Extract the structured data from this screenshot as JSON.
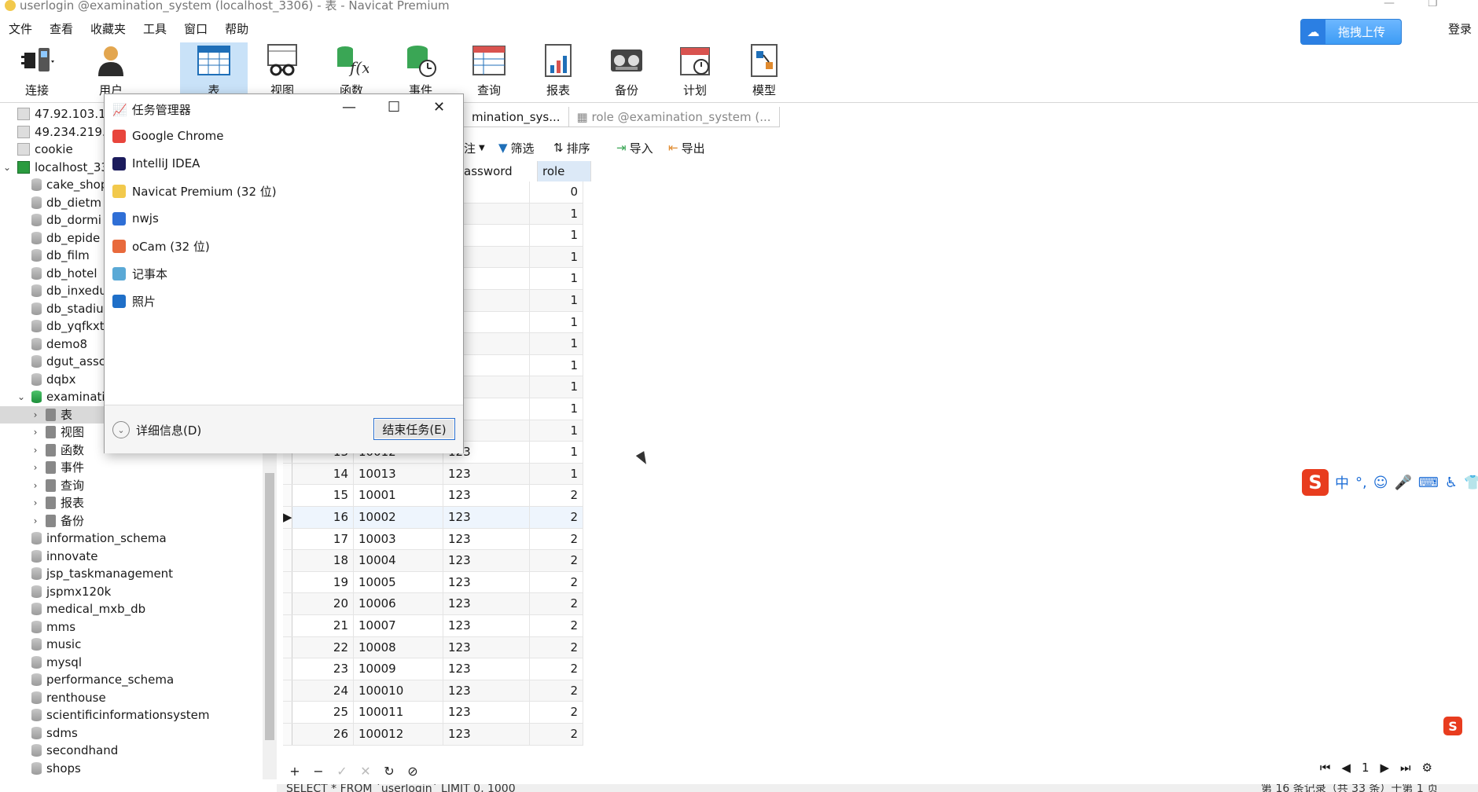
{
  "window": {
    "title": "userlogin @examination_system (localhost_3306) - 表 - Navicat Premium"
  },
  "menu": [
    "文件",
    "查看",
    "收藏夹",
    "工具",
    "窗口",
    "帮助"
  ],
  "upload_label": "拖拽上传",
  "login_label": "登录",
  "toolbar": [
    {
      "label": "连接",
      "icon": "plug-icon"
    },
    {
      "label": "用户",
      "icon": "user-icon"
    },
    {
      "label": "表",
      "icon": "table-icon"
    },
    {
      "label": "视图",
      "icon": "view-icon"
    },
    {
      "label": "函数",
      "icon": "function-icon"
    },
    {
      "label": "事件",
      "icon": "event-icon"
    },
    {
      "label": "查询",
      "icon": "query-icon"
    },
    {
      "label": "报表",
      "icon": "report-icon"
    },
    {
      "label": "备份",
      "icon": "backup-icon"
    },
    {
      "label": "计划",
      "icon": "schedule-icon"
    },
    {
      "label": "模型",
      "icon": "model-icon"
    }
  ],
  "sidebar": {
    "items": [
      {
        "label": "47.92.103.14",
        "kind": "conn"
      },
      {
        "label": "49.234.219.1",
        "kind": "conn"
      },
      {
        "label": "cookie",
        "kind": "conn"
      },
      {
        "label": "localhost_33",
        "kind": "conn-green"
      },
      {
        "label": "cake_shop",
        "kind": "db"
      },
      {
        "label": "db_dietm",
        "kind": "db"
      },
      {
        "label": "db_dormi",
        "kind": "db"
      },
      {
        "label": "db_epide",
        "kind": "db"
      },
      {
        "label": "db_film",
        "kind": "db"
      },
      {
        "label": "db_hotel",
        "kind": "db"
      },
      {
        "label": "db_inxedu",
        "kind": "db"
      },
      {
        "label": "db_stadiu",
        "kind": "db"
      },
      {
        "label": "db_yqfkxt",
        "kind": "db"
      },
      {
        "label": "demo8",
        "kind": "db"
      },
      {
        "label": "dgut_assc",
        "kind": "db"
      },
      {
        "label": "dqbx",
        "kind": "db"
      },
      {
        "label": "examinati",
        "kind": "db-green"
      },
      {
        "label": "表",
        "kind": "node"
      },
      {
        "label": "视图",
        "kind": "node"
      },
      {
        "label": "函数",
        "kind": "node"
      },
      {
        "label": "事件",
        "kind": "node"
      },
      {
        "label": "查询",
        "kind": "node"
      },
      {
        "label": "报表",
        "kind": "node"
      },
      {
        "label": "备份",
        "kind": "node"
      },
      {
        "label": "information_schema",
        "kind": "db"
      },
      {
        "label": "innovate",
        "kind": "db"
      },
      {
        "label": "jsp_taskmanagement",
        "kind": "db"
      },
      {
        "label": "jspmx120k",
        "kind": "db"
      },
      {
        "label": "medical_mxb_db",
        "kind": "db"
      },
      {
        "label": "mms",
        "kind": "db"
      },
      {
        "label": "music",
        "kind": "db"
      },
      {
        "label": "mysql",
        "kind": "db"
      },
      {
        "label": "performance_schema",
        "kind": "db"
      },
      {
        "label": "renthouse",
        "kind": "db"
      },
      {
        "label": "scientificinformationsystem",
        "kind": "db"
      },
      {
        "label": "sdms",
        "kind": "db"
      },
      {
        "label": "secondhand",
        "kind": "db"
      },
      {
        "label": "shops",
        "kind": "db"
      }
    ]
  },
  "tabs": [
    {
      "label": "mination_sys..."
    },
    {
      "label": "role @examination_system (..."
    }
  ],
  "subtoolbar": {
    "note": "注",
    "filter": "筛选",
    "sort": "排序",
    "import": "导入",
    "export": "导出"
  },
  "grid": {
    "headers": {
      "password": "assword",
      "role": "role"
    },
    "rows": [
      {
        "id": "",
        "user": "",
        "pwd": "23",
        "role": "0"
      },
      {
        "id": "",
        "user": "",
        "pwd": "23",
        "role": "1"
      },
      {
        "id": "",
        "user": "",
        "pwd": "23",
        "role": "1"
      },
      {
        "id": "",
        "user": "",
        "pwd": "23",
        "role": "1"
      },
      {
        "id": "",
        "user": "",
        "pwd": "23",
        "role": "1"
      },
      {
        "id": "",
        "user": "",
        "pwd": "23",
        "role": "1"
      },
      {
        "id": "",
        "user": "",
        "pwd": "2",
        "role": "1"
      },
      {
        "id": "",
        "user": "",
        "pwd": "23",
        "role": "1"
      },
      {
        "id": "",
        "user": "",
        "pwd": "23",
        "role": "1"
      },
      {
        "id": "",
        "user": "",
        "pwd": "23",
        "role": "1"
      },
      {
        "id": "",
        "user": "",
        "pwd": "23",
        "role": "1"
      },
      {
        "id": "",
        "user": "",
        "pwd": "23",
        "role": "1"
      },
      {
        "id": "13",
        "user": "10012",
        "pwd": "123",
        "role": "1"
      },
      {
        "id": "14",
        "user": "10013",
        "pwd": "123",
        "role": "1"
      },
      {
        "id": "15",
        "user": "10001",
        "pwd": "123",
        "role": "2"
      },
      {
        "id": "16",
        "user": "10002",
        "pwd": "123",
        "role": "2"
      },
      {
        "id": "17",
        "user": "10003",
        "pwd": "123",
        "role": "2"
      },
      {
        "id": "18",
        "user": "10004",
        "pwd": "123",
        "role": "2"
      },
      {
        "id": "19",
        "user": "10005",
        "pwd": "123",
        "role": "2"
      },
      {
        "id": "20",
        "user": "10006",
        "pwd": "123",
        "role": "2"
      },
      {
        "id": "21",
        "user": "10007",
        "pwd": "123",
        "role": "2"
      },
      {
        "id": "22",
        "user": "10008",
        "pwd": "123",
        "role": "2"
      },
      {
        "id": "23",
        "user": "10009",
        "pwd": "123",
        "role": "2"
      },
      {
        "id": "24",
        "user": "100010",
        "pwd": "123",
        "role": "2"
      },
      {
        "id": "25",
        "user": "100011",
        "pwd": "123",
        "role": "2"
      },
      {
        "id": "26",
        "user": "100012",
        "pwd": "123",
        "role": "2"
      }
    ]
  },
  "pager": {
    "page": "1"
  },
  "status": {
    "sql": "SELECT * FROM `userlogin` LIMIT 0, 1000",
    "records": "第 16 条记录（共 33 条）于第 1 页"
  },
  "taskmanager": {
    "title": "任务管理器",
    "apps": [
      {
        "label": "Google Chrome",
        "color": "#e8453c"
      },
      {
        "label": "IntelliJ IDEA",
        "color": "#1b1b5c"
      },
      {
        "label": "Navicat Premium (32 位)",
        "color": "#f2c94c"
      },
      {
        "label": "nwjs",
        "color": "#2f6fd6"
      },
      {
        "label": "oCam (32 位)",
        "color": "#e86a3c"
      },
      {
        "label": "记事本",
        "color": "#5aa9d6"
      },
      {
        "label": "照片",
        "color": "#1f6fc8"
      }
    ],
    "more_details": "详细信息(D)",
    "end_task": "结束任务(E)"
  },
  "ime": {
    "mode": "中"
  }
}
